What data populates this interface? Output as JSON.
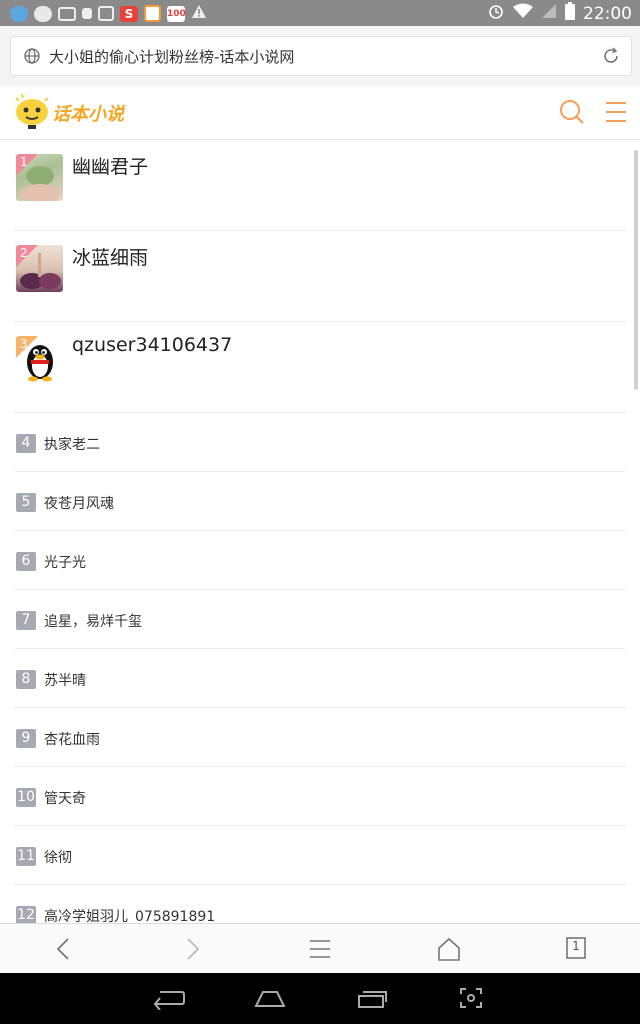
{
  "status_bar": {
    "time": "22:00",
    "left_icons": [
      "weather-icon",
      "cloud-icon",
      "battery-saver-icon",
      "lock-icon",
      "image-icon",
      "app-s-icon",
      "app-store-icon",
      "app-100-icon",
      "warning-icon"
    ],
    "right_icons": [
      "alarm-icon",
      "wifi-icon",
      "signal-icon",
      "battery-icon"
    ]
  },
  "browser": {
    "url_title": "大小姐的偷心计划粉丝榜-话本小说网"
  },
  "site": {
    "logo_text": "话本小说",
    "accent_color": "#f5a05a"
  },
  "top_fans": [
    {
      "rank": "1",
      "name": "幽幽君子"
    },
    {
      "rank": "2",
      "name": "冰蓝细雨"
    },
    {
      "rank": "3",
      "name": "qzuser34106437"
    }
  ],
  "fans": [
    {
      "rank": "4",
      "name": "执家老二"
    },
    {
      "rank": "5",
      "name": "夜苍月风魂"
    },
    {
      "rank": "6",
      "name": "光子光"
    },
    {
      "rank": "7",
      "name": "追星，易烊千玺"
    },
    {
      "rank": "8",
      "name": "苏半晴"
    },
    {
      "rank": "9",
      "name": "杏花血雨"
    },
    {
      "rank": "10",
      "name": "管天奇"
    },
    {
      "rank": "11",
      "name": "徐彻"
    },
    {
      "rank": "12",
      "name": "高冷学姐羽儿_075891891"
    }
  ],
  "browser_toolbar": {
    "tab_count": "1"
  }
}
